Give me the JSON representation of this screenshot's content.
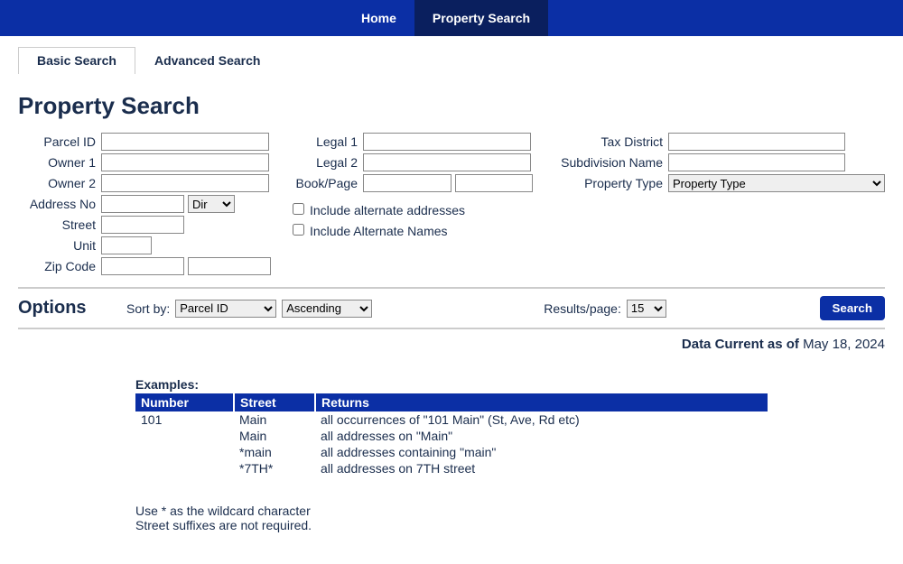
{
  "nav": {
    "home": "Home",
    "property_search": "Property Search"
  },
  "tabs": {
    "basic": "Basic Search",
    "advanced": "Advanced Search"
  },
  "page_title": "Property Search",
  "labels": {
    "parcel_id": "Parcel ID",
    "owner1": "Owner 1",
    "owner2": "Owner 2",
    "address_no": "Address No",
    "dir": "Dir",
    "street": "Street",
    "unit": "Unit",
    "zip_code": "Zip Code",
    "legal1": "Legal 1",
    "legal2": "Legal 2",
    "book_page": "Book/Page",
    "include_alt_addr": "Include alternate addresses",
    "include_alt_names": "Include Alternate Names",
    "tax_district": "Tax District",
    "subdivision": "Subdivision Name",
    "property_type": "Property Type",
    "property_type_opt": "Property Type"
  },
  "options": {
    "title": "Options",
    "sort_by_label": "Sort by:",
    "sort_by_value": "Parcel ID",
    "order_value": "Ascending",
    "results_label": "Results/page:",
    "results_value": "15",
    "search_button": "Search"
  },
  "data_current": {
    "prefix": "Data Current as of ",
    "date": "May 18, 2024"
  },
  "examples": {
    "title": "Examples:",
    "header_number": "Number",
    "header_street": "Street",
    "header_returns": "Returns",
    "rows": [
      {
        "number": "101",
        "street": "Main",
        "returns": "all occurrences of \"101 Main\" (St, Ave, Rd etc)"
      },
      {
        "number": "",
        "street": "Main",
        "returns": "all addresses on \"Main\""
      },
      {
        "number": "",
        "street": "*main",
        "returns": "all addresses containing \"main\""
      },
      {
        "number": "",
        "street": "*7TH*",
        "returns": "all addresses on 7TH street"
      }
    ]
  },
  "notes": {
    "line1": "Use * as the wildcard character",
    "line2": "Street suffixes are not required."
  }
}
